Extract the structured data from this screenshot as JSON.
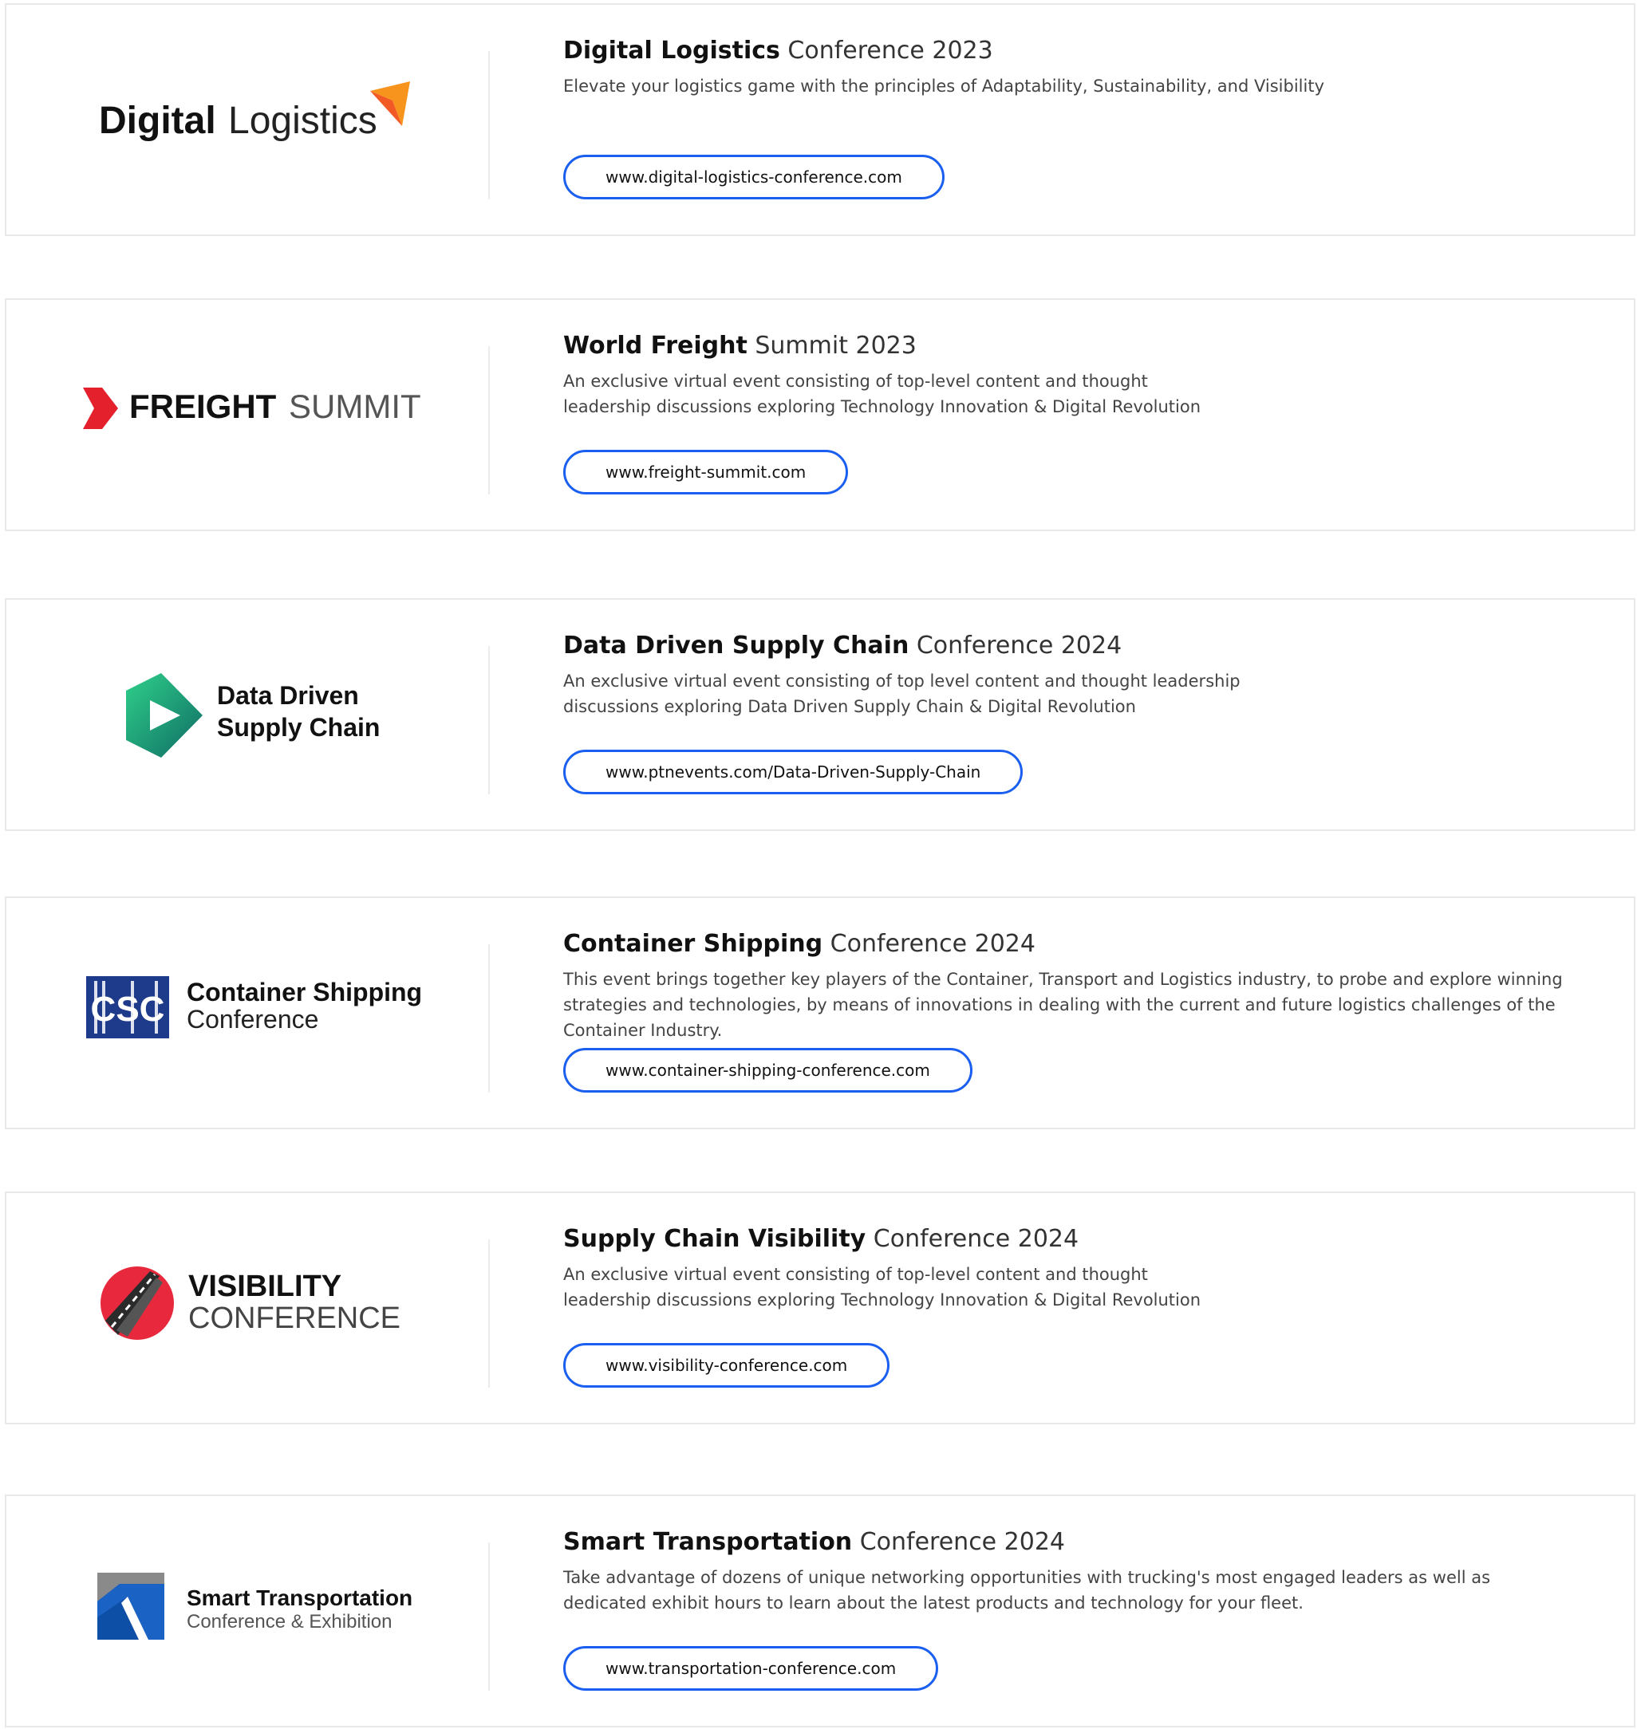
{
  "cards": [
    {
      "logo": {
        "word1": "Digital",
        "word2": "Logistics"
      },
      "title_bold": "Digital Logistics",
      "title_rest": " Conference 2023",
      "description": "Elevate your logistics game with the principles of Adaptability, Sustainability, and Visibility",
      "url": "www.digital-logistics-conference.com"
    },
    {
      "logo": {
        "word1": "FREIGHT",
        "word2": "SUMMIT"
      },
      "title_bold": "World Freight",
      "title_rest": " Summit 2023",
      "description": "An exclusive virtual event consisting of top-level content and thought leadership discussions exploring Technology Innovation & Digital Revolution",
      "url": "www.freight-summit.com"
    },
    {
      "logo": {
        "line1": "Data Driven",
        "line2": "Supply Chain"
      },
      "title_bold": "Data Driven Supply Chain",
      "title_rest": " Conference 2024",
      "description": "An exclusive virtual event consisting of top level content and thought leadership discussions exploring Data Driven Supply Chain & Digital Revolution",
      "url": "www.ptnevents.com/Data-Driven-Supply-Chain"
    },
    {
      "logo": {
        "mark": "CSC",
        "line1": "Container Shipping",
        "line2": "Conference"
      },
      "title_bold": "Container Shipping",
      "title_rest": " Conference 2024",
      "description": "This event brings together key players of the Container, Transport and Logistics industry, to probe and explore winning strategies and technologies, by means of innovations in dealing with the current and future logistics challenges of the Container Industry.",
      "url": "www.container-shipping-conference.com"
    },
    {
      "logo": {
        "line1": "VISIBILITY",
        "line2": "CONFERENCE"
      },
      "title_bold": "Supply Chain Visibility",
      "title_rest": " Conference 2024",
      "description": "An exclusive virtual event consisting of top-level content and thought leadership discussions exploring Technology Innovation & Digital Revolution",
      "url": "www.visibility-conference.com"
    },
    {
      "logo": {
        "line1": "Smart Transportation",
        "line2": "Conference & Exhibition"
      },
      "title_bold": "Smart Transportation",
      "title_rest": " Conference 2024",
      "description": "Take advantage of dozens of unique networking opportunities with trucking's most engaged leaders as well as dedicated exhibit hours to learn about the latest products and technology for your fleet.",
      "url": "www.transportation-conference.com"
    }
  ],
  "colors": {
    "button_border": "#1a5ff0",
    "digital_logistics_arrow": "#f7941d",
    "freight_red": "#e3202b",
    "data_driven_green": "#1fb57a",
    "csc_blue": "#1e3a8a",
    "visibility_red": "#e8283c",
    "transport_blue": "#0d4fa6"
  }
}
